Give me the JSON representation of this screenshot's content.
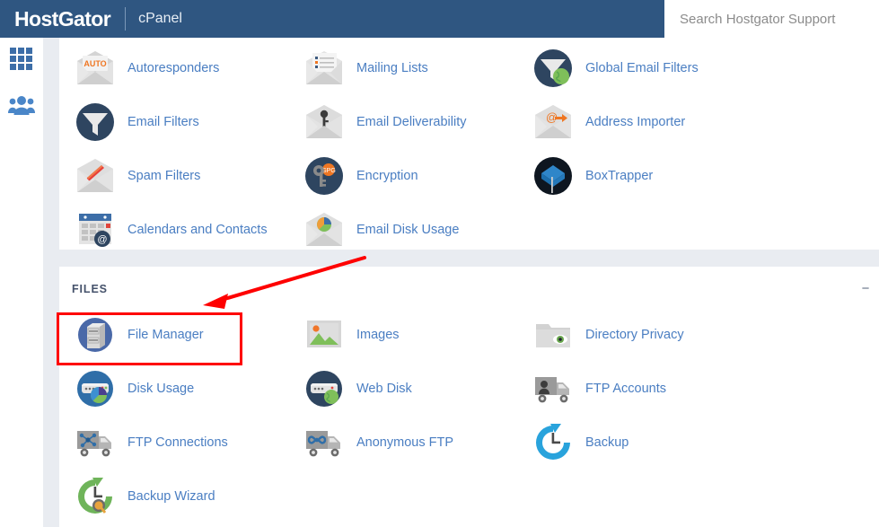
{
  "header": {
    "brand": "HostGator",
    "product": "cPanel",
    "search": {
      "placeholder": "Search Hostgator Support",
      "value": ""
    }
  },
  "sidebar": {
    "items": [
      {
        "name": "apps-grid-icon",
        "label": ""
      },
      {
        "name": "users-icon",
        "label": ""
      }
    ]
  },
  "colors": {
    "header_bg": "#2f5681",
    "link_blue": "#4a7ec2",
    "panel_bg": "#ffffff",
    "page_bg": "#e9ecf1",
    "annotation_red": "#fe0000",
    "heading_gray": "#45526b"
  },
  "sections": [
    {
      "id": "email",
      "title": "",
      "collapse_label": "",
      "items": [
        {
          "label": "Autoresponders",
          "icon": "autoresponders-icon"
        },
        {
          "label": "Mailing Lists",
          "icon": "mailing-lists-icon"
        },
        {
          "label": "Global Email Filters",
          "icon": "global-email-filters-icon"
        },
        {
          "label": "Email Filters",
          "icon": "email-filters-icon"
        },
        {
          "label": "Email Deliverability",
          "icon": "email-deliverability-icon"
        },
        {
          "label": "Address Importer",
          "icon": "address-importer-icon"
        },
        {
          "label": "Spam Filters",
          "icon": "spam-filters-icon"
        },
        {
          "label": "Encryption",
          "icon": "encryption-icon"
        },
        {
          "label": "BoxTrapper",
          "icon": "boxtrapper-icon"
        },
        {
          "label": "Calendars and Contacts",
          "icon": "calendars-contacts-icon"
        },
        {
          "label": "Email Disk Usage",
          "icon": "email-disk-usage-icon"
        }
      ]
    },
    {
      "id": "files",
      "title": "FILES",
      "collapse_label": "−",
      "items": [
        {
          "label": "File Manager",
          "icon": "file-manager-icon"
        },
        {
          "label": "Images",
          "icon": "images-icon"
        },
        {
          "label": "Directory Privacy",
          "icon": "directory-privacy-icon"
        },
        {
          "label": "Disk Usage",
          "icon": "disk-usage-icon"
        },
        {
          "label": "Web Disk",
          "icon": "web-disk-icon"
        },
        {
          "label": "FTP Accounts",
          "icon": "ftp-accounts-icon"
        },
        {
          "label": "FTP Connections",
          "icon": "ftp-connections-icon"
        },
        {
          "label": "Anonymous FTP",
          "icon": "anonymous-ftp-icon"
        },
        {
          "label": "Backup",
          "icon": "backup-icon"
        },
        {
          "label": "Backup Wizard",
          "icon": "backup-wizard-icon"
        }
      ]
    }
  ],
  "annotations": {
    "highlight_target": "File Manager",
    "arrow": "points to File Manager"
  }
}
